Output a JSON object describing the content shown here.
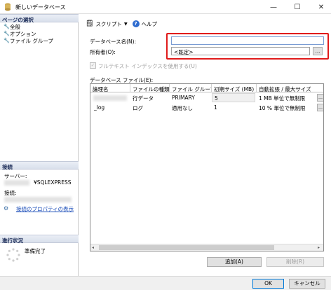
{
  "window": {
    "title": "新しいデータベース",
    "minimize": "—",
    "maximize": "☐",
    "close": "✕"
  },
  "left": {
    "page_select_header": "ページの選択",
    "pages": [
      "全般",
      "オプション",
      "ファイル グループ"
    ],
    "connection_header": "接続",
    "server_label": "サーバー:",
    "server_value": "¥SQLEXPRESS",
    "connection_label": "接続:",
    "conn_props_link": "接続のプロパティの表示",
    "progress_header": "進行状況",
    "progress_status": "準備完了"
  },
  "toolbar": {
    "script": "スクリプト",
    "script_caret": "▼",
    "help": "ヘルプ"
  },
  "form": {
    "dbname_label": "データベース名(N):",
    "dbname_value": "",
    "owner_label": "所有者(O):",
    "owner_value": "<既定>",
    "browse_label": "...",
    "fulltext_label": "フルテキスト インデックスを使用する(U)",
    "files_label": "データベース ファイル(E):"
  },
  "grid": {
    "columns": [
      "論理名",
      "ファイルの種類",
      "ファイル グループ",
      "初期サイズ (MB)",
      "自動拡張 / 最大サイズ"
    ],
    "rows": [
      {
        "name": "",
        "type": "行データ",
        "group": "PRIMARY",
        "size": "5",
        "growth": "1 MB 単位で無制限"
      },
      {
        "name": "_log",
        "type": "ログ",
        "group": "適用なし",
        "size": "1",
        "growth": "10 % 単位で無制限"
      }
    ]
  },
  "buttons": {
    "add": "追加(A)",
    "remove": "削除(R)",
    "ok": "OK",
    "cancel": "キャンセル"
  }
}
